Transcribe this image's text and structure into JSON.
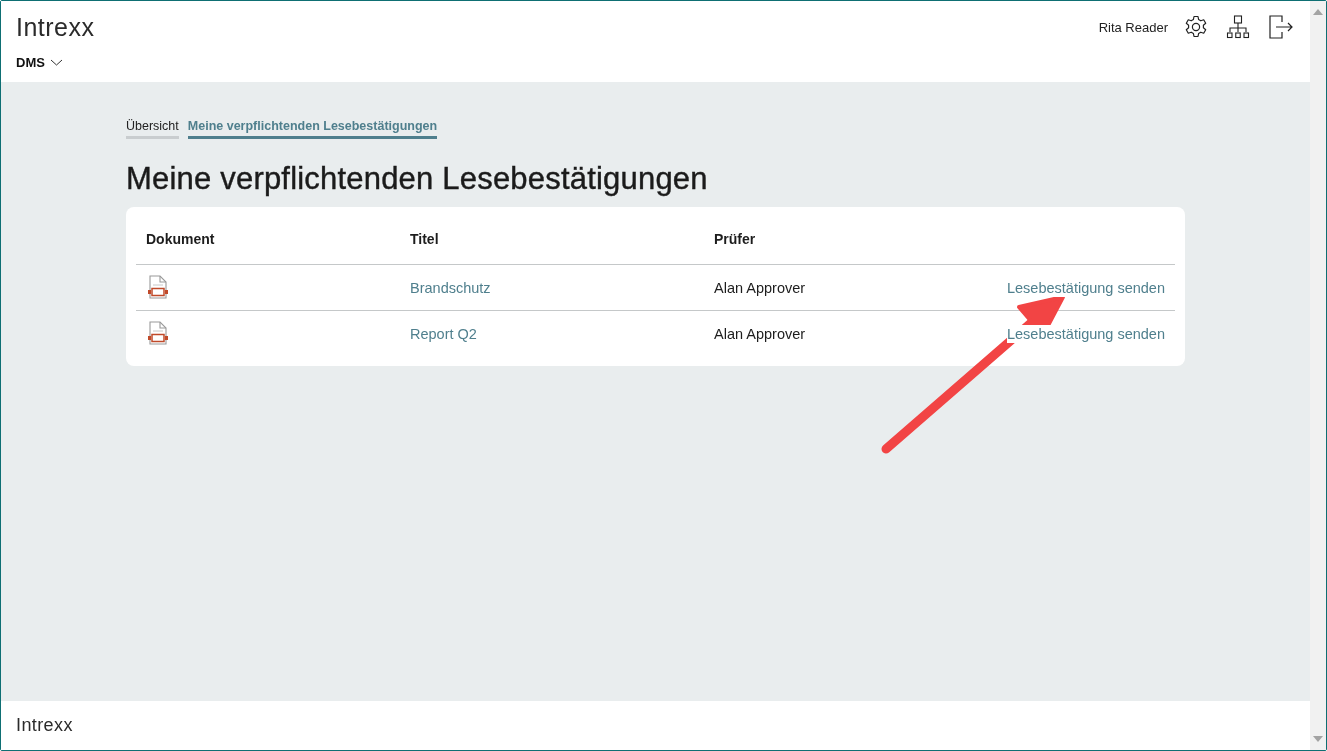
{
  "header": {
    "logo": "Intrexx",
    "app_menu": "DMS",
    "user": "Rita Reader"
  },
  "tabs": [
    {
      "label": "Übersicht",
      "selected": false
    },
    {
      "label": "Meine verpflichtenden Lesebestätigungen",
      "selected": true
    }
  ],
  "page_title": "Meine verpflichtenden Lesebestätigungen",
  "table": {
    "columns": [
      "Dokument",
      "Titel",
      "Prüfer"
    ],
    "rows": [
      {
        "title": "Brandschutz",
        "reviewer": "Alan Approver",
        "action": "Lesebestätigung senden"
      },
      {
        "title": "Report Q2",
        "reviewer": "Alan Approver",
        "action": "Lesebestätigung senden"
      }
    ]
  },
  "footer": {
    "logo": "Intrexx"
  }
}
